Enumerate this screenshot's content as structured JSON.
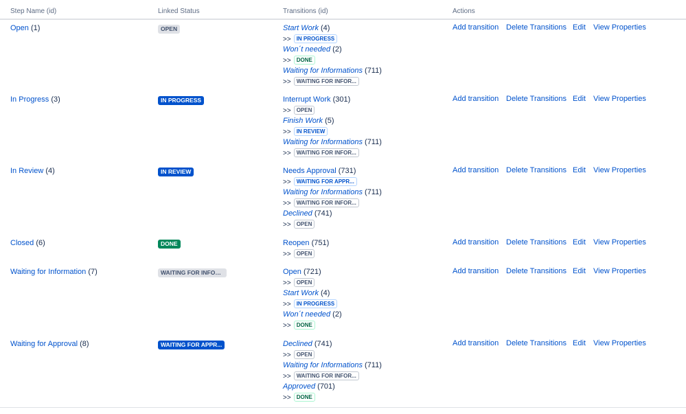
{
  "headers": {
    "step": "Step Name (id)",
    "status": "Linked Status",
    "transitions": "Transitions (id)",
    "actions": "Actions"
  },
  "actions": {
    "add": "Add transition",
    "delete": "Delete Transitions",
    "edit": "Edit",
    "view": "View Properties"
  },
  "arrow": ">>",
  "rows": [
    {
      "name": "Open",
      "id": "(1)",
      "status": {
        "label": "OPEN",
        "tone": "grey"
      },
      "transitions": [
        {
          "name": "Start Work",
          "id": "(4)",
          "italic": true,
          "target": "IN PROGRESS",
          "tone": "blue"
        },
        {
          "name": "Won´t needed",
          "id": "(2)",
          "italic": true,
          "target": "DONE",
          "tone": "green"
        },
        {
          "name": "Waiting for Informations",
          "id": "(711)",
          "italic": true,
          "target": "WAITING FOR INFOR...",
          "tone": "grey"
        }
      ]
    },
    {
      "name": "In Progress",
      "id": "(3)",
      "status": {
        "label": "IN PROGRESS",
        "tone": "blue"
      },
      "transitions": [
        {
          "name": "Interrupt Work",
          "id": "(301)",
          "italic": false,
          "target": "OPEN",
          "tone": "grey"
        },
        {
          "name": "Finish Work",
          "id": "(5)",
          "italic": true,
          "target": "IN REVIEW",
          "tone": "blue"
        },
        {
          "name": "Waiting for Informations",
          "id": "(711)",
          "italic": true,
          "target": "WAITING FOR INFOR...",
          "tone": "grey"
        }
      ]
    },
    {
      "name": "In Review",
      "id": "(4)",
      "status": {
        "label": "IN REVIEW",
        "tone": "blue"
      },
      "transitions": [
        {
          "name": "Needs Approval",
          "id": "(731)",
          "italic": false,
          "target": "WAITING FOR APPR...",
          "tone": "blue"
        },
        {
          "name": "Waiting for Informations",
          "id": "(711)",
          "italic": true,
          "target": "WAITING FOR INFOR...",
          "tone": "grey"
        },
        {
          "name": "Declined",
          "id": "(741)",
          "italic": true,
          "target": "OPEN",
          "tone": "grey"
        }
      ]
    },
    {
      "name": "Closed",
      "id": "(6)",
      "status": {
        "label": "DONE",
        "tone": "green"
      },
      "transitions": [
        {
          "name": "Reopen",
          "id": "(751)",
          "italic": false,
          "target": "OPEN",
          "tone": "grey"
        }
      ]
    },
    {
      "name": "Waiting for Information",
      "id": "(7)",
      "status": {
        "label": "WAITING FOR INFOR...",
        "tone": "grey"
      },
      "transitions": [
        {
          "name": "Open",
          "id": "(721)",
          "italic": false,
          "target": "OPEN",
          "tone": "grey"
        },
        {
          "name": "Start Work",
          "id": "(4)",
          "italic": true,
          "target": "IN PROGRESS",
          "tone": "blue"
        },
        {
          "name": "Won´t needed",
          "id": "(2)",
          "italic": true,
          "target": "DONE",
          "tone": "green"
        }
      ]
    },
    {
      "name": "Waiting for Approval",
      "id": "(8)",
      "status": {
        "label": "WAITING FOR APPR...",
        "tone": "blue"
      },
      "transitions": [
        {
          "name": "Declined",
          "id": "(741)",
          "italic": true,
          "target": "OPEN",
          "tone": "grey"
        },
        {
          "name": "Waiting for Informations",
          "id": "(711)",
          "italic": true,
          "target": "WAITING FOR INFOR...",
          "tone": "grey"
        },
        {
          "name": "Approved",
          "id": "(701)",
          "italic": true,
          "target": "DONE",
          "tone": "green"
        }
      ]
    }
  ]
}
